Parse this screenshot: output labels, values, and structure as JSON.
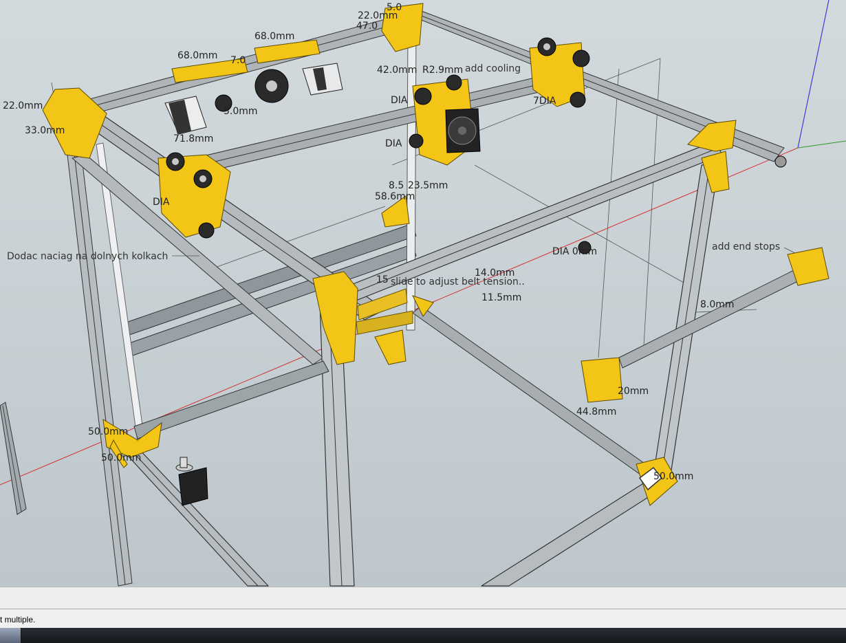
{
  "dimensions": {
    "d1": "22.0mm",
    "d2": "47.0",
    "d3": "5.0",
    "d4": "68.0mm",
    "d5": "68.0mm",
    "d6": "7.0",
    "d7": "42.0mm",
    "d8": "R2.9mm",
    "d9": "22.0mm",
    "d10": "33.0mm",
    "d11": "71.8mm",
    "d12": "5.0mm",
    "d13": "8.5",
    "d14": "23.5mm",
    "d15": "58.6mm",
    "d16": "14.0mm",
    "d17": "11.5mm",
    "d18": "8.0mm",
    "d19": "50.0mm",
    "d20": "50.0mm",
    "d21": "50.0mm",
    "d22": "44.8mm",
    "d23": "DIA",
    "d24": "DIA",
    "d25": "DIA",
    "d26": "7DIA",
    "d27": "DIA 0mm",
    "d28": "15",
    "d29": "20mm"
  },
  "notes": {
    "cooling": "add cooling",
    "tension": "slide to adjust belt tension..",
    "endstops": "add end stops",
    "naciag": "Dodac naciag na dolnych kolkach"
  },
  "status": {
    "text": "t multiple."
  }
}
